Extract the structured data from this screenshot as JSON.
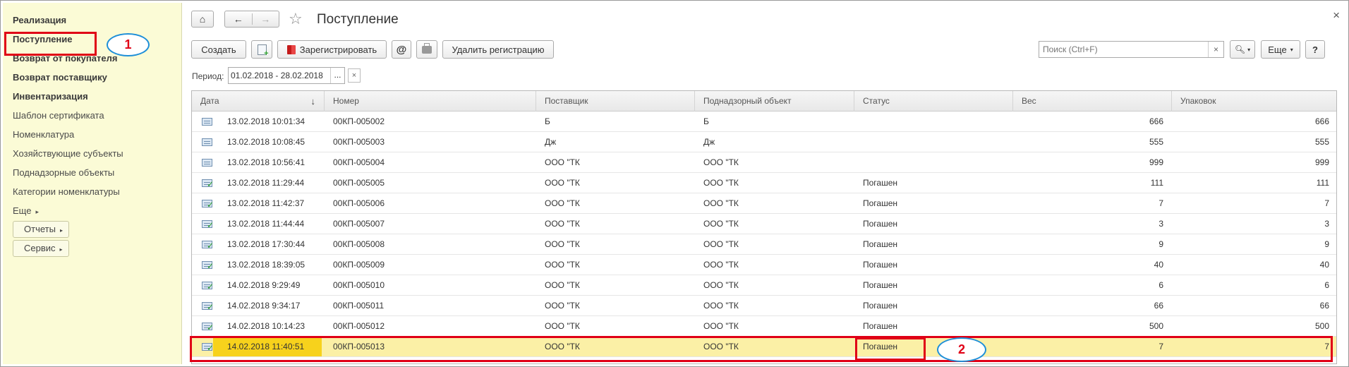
{
  "sidebar": {
    "items": [
      {
        "label": "Реализация",
        "bold": true
      },
      {
        "label": "Поступление",
        "bold": true
      },
      {
        "label": "Возврат от покупателя",
        "bold": true
      },
      {
        "label": "Возврат поставщику",
        "bold": true
      },
      {
        "label": "Инвентаризация",
        "bold": true
      },
      {
        "label": "Шаблон сертификата",
        "bold": false
      },
      {
        "label": "Номенклатура",
        "bold": false
      },
      {
        "label": "Хозяйствующие субъекты",
        "bold": false
      },
      {
        "label": "Поднадзорные объекты",
        "bold": false
      },
      {
        "label": "Категории номенклатуры",
        "bold": false
      }
    ],
    "more_label": "Еще",
    "reports_label": "Отчеты",
    "service_label": "Сервис"
  },
  "header": {
    "title": "Поступление",
    "close_glyph": "×"
  },
  "toolbar": {
    "create_label": "Создать",
    "register_label": "Зарегистрировать",
    "email_glyph": "@",
    "delete_registration_label": "Удалить регистрацию",
    "search_placeholder": "Поиск (Ctrl+F)",
    "more_label": "Еще",
    "help_label": "?"
  },
  "filter": {
    "period_label": "Период:",
    "period_value": "01.02.2018 - 28.02.2018",
    "dots": "...",
    "clear": "×"
  },
  "table": {
    "columns": [
      "Дата",
      "Номер",
      "Поставщик",
      "Поднадзорный объект",
      "Статус",
      "Вес",
      "Упаковок"
    ],
    "sort_glyph": "↓",
    "rows": [
      {
        "date": "13.02.2018 10:01:34",
        "number": "00КП-005002",
        "supplier": "Б",
        "object": "Б",
        "status": "",
        "weight": "666",
        "packs": "666",
        "posted": false
      },
      {
        "date": "13.02.2018 10:08:45",
        "number": "00КП-005003",
        "supplier": "Дж",
        "object": "Дж",
        "status": "",
        "weight": "555",
        "packs": "555",
        "posted": false
      },
      {
        "date": "13.02.2018 10:56:41",
        "number": "00КП-005004",
        "supplier": "ООО \"ТК",
        "object": "ООО \"ТК",
        "status": "",
        "weight": "999",
        "packs": "999",
        "posted": false
      },
      {
        "date": "13.02.2018 11:29:44",
        "number": "00КП-005005",
        "supplier": "ООО \"ТК",
        "object": "ООО \"ТК",
        "status": "Погашен",
        "weight": "111",
        "packs": "111",
        "posted": true
      },
      {
        "date": "13.02.2018 11:42:37",
        "number": "00КП-005006",
        "supplier": "ООО \"ТК",
        "object": "ООО \"ТК",
        "status": "Погашен",
        "weight": "7",
        "packs": "7",
        "posted": true
      },
      {
        "date": "13.02.2018 11:44:44",
        "number": "00КП-005007",
        "supplier": "ООО \"ТК",
        "object": "ООО \"ТК",
        "status": "Погашен",
        "weight": "3",
        "packs": "3",
        "posted": true
      },
      {
        "date": "13.02.2018 17:30:44",
        "number": "00КП-005008",
        "supplier": "ООО \"ТК",
        "object": "ООО \"ТК",
        "status": "Погашен",
        "weight": "9",
        "packs": "9",
        "posted": true
      },
      {
        "date": "13.02.2018 18:39:05",
        "number": "00КП-005009",
        "supplier": "ООО \"ТК",
        "object": "ООО \"ТК",
        "status": "Погашен",
        "weight": "40",
        "packs": "40",
        "posted": true
      },
      {
        "date": "14.02.2018 9:29:49",
        "number": "00КП-005010",
        "supplier": "ООО \"ТК",
        "object": "ООО \"ТК",
        "status": "Погашен",
        "weight": "6",
        "packs": "6",
        "posted": true
      },
      {
        "date": "14.02.2018 9:34:17",
        "number": "00КП-005011",
        "supplier": "ООО \"ТК",
        "object": "ООО \"ТК",
        "status": "Погашен",
        "weight": "66",
        "packs": "66",
        "posted": true
      },
      {
        "date": "14.02.2018 10:14:23",
        "number": "00КП-005012",
        "supplier": "ООО \"ТК",
        "object": "ООО \"ТК",
        "status": "Погашен",
        "weight": "500",
        "packs": "500",
        "posted": true
      },
      {
        "date": "14.02.2018 11:40:51",
        "number": "00КП-005013",
        "supplier": "ООО \"ТК",
        "object": "ООО \"ТК",
        "status": "Погашен",
        "weight": "7",
        "packs": "7",
        "posted": true,
        "selected": true
      }
    ]
  },
  "annotations": {
    "marker_1": "1",
    "marker_2": "2",
    "color": "#e00016"
  }
}
